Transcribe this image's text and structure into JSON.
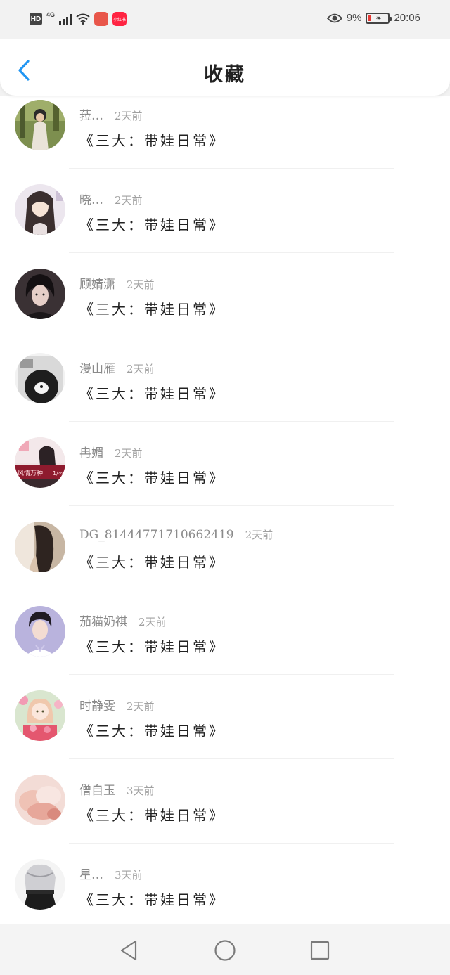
{
  "status_bar": {
    "hd": "HD",
    "network": "4G",
    "app_badge_1": "xiaohongshu",
    "app_badge_2": "小红书",
    "battery_percent": "9%",
    "time": "20:06",
    "battery_level": 0.09
  },
  "header": {
    "title": "收藏",
    "back_icon": "chevron-left-icon",
    "accent_color": "#2196f3"
  },
  "items": [
    {
      "username": "菈…",
      "time": "2天前",
      "title": "《三大：带娃日常》",
      "avatar": "avatar-girl-in-garden"
    },
    {
      "username": "晓…",
      "time": "2天前",
      "title": "《三大：带娃日常》",
      "avatar": "avatar-anime-girl"
    },
    {
      "username": "顾婧潇",
      "time": "2天前",
      "title": "《三大：带娃日常》",
      "avatar": "avatar-dark-hair-boy"
    },
    {
      "username": "漫山雁",
      "time": "2天前",
      "title": "《三大：带娃日常》",
      "avatar": "avatar-mickey-bw"
    },
    {
      "username": "冉媚",
      "time": "2天前",
      "title": "《三大：带娃日常》",
      "avatar": "avatar-drama-still",
      "avatar_text": "风情万种",
      "avatar_page": "1/∞"
    },
    {
      "username": "DG_81444771710662419",
      "time": "2天前",
      "title": "《三大：带娃日常》",
      "avatar": "avatar-long-hair-back"
    },
    {
      "username": "茄猫奶祺",
      "time": "2天前",
      "title": "《三大：带娃日常》",
      "avatar": "avatar-young-man"
    },
    {
      "username": "时静雯",
      "time": "2天前",
      "title": "《三大：带娃日常》",
      "avatar": "avatar-cartoon-girl-flowers"
    },
    {
      "username": "僧自玉",
      "time": "3天前",
      "title": "《三大：带娃日常》",
      "avatar": "avatar-blurry-pink"
    },
    {
      "username": "星…",
      "time": "3天前",
      "title": "《三大：带娃日常》",
      "avatar": "avatar-silver-dress"
    }
  ],
  "nav_bar": {
    "back": "triangle-back-icon",
    "home": "circle-home-icon",
    "recents": "square-recents-icon"
  }
}
